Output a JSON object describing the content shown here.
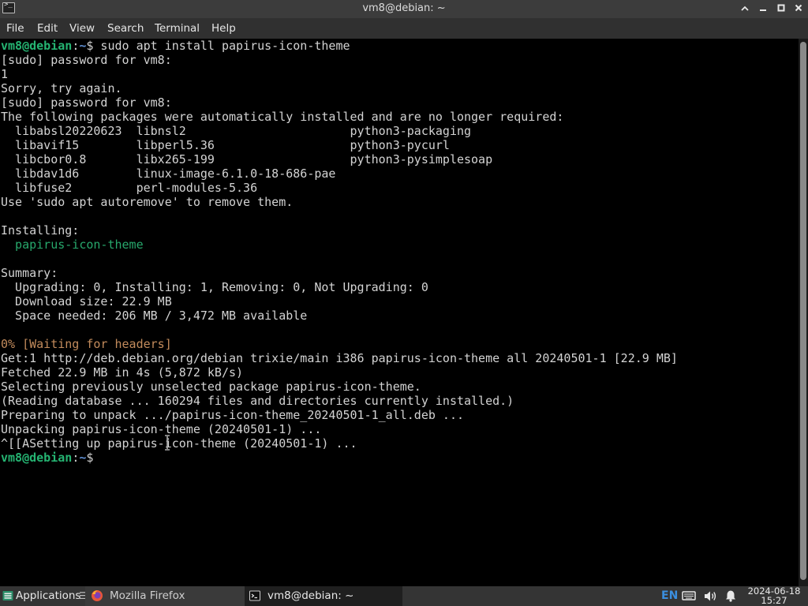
{
  "window": {
    "title": "vm8@debian: ~",
    "icon": "terminal-icon",
    "controls": [
      "minimize-up-icon",
      "minimize-icon",
      "maximize-icon",
      "close-icon"
    ]
  },
  "menu": [
    "File",
    "Edit",
    "View",
    "Search",
    "Terminal",
    "Help"
  ],
  "terminal": {
    "prompt_user": "vm8@debian",
    "prompt_sep": ":",
    "prompt_path": "~",
    "prompt_symbol": "$",
    "command": " sudo apt install papirus-icon-theme",
    "lines": [
      "[sudo] password for vm8:",
      "1",
      "Sorry, try again.",
      "[sudo] password for vm8:",
      "The following packages were automatically installed and are no longer required:",
      "  libabsl20220623  libnsl2                       python3-packaging",
      "  libavif15        libperl5.36                   python3-pycurl",
      "  libcbor0.8       libx265-199                   python3-pysimplesoap",
      "  libdav1d6        linux-image-6.1.0-18-686-pae",
      "  libfuse2         perl-modules-5.36",
      "Use 'sudo apt autoremove' to remove them.",
      "",
      "Installing:"
    ],
    "installing_pkg": "  papirus-icon-theme",
    "summary_lines": [
      "",
      "Summary:",
      "  Upgrading: 0, Installing: 1, Removing: 0, Not Upgrading: 0",
      "  Download size: 22.9 MB",
      "  Space needed: 206 MB / 3,472 MB available",
      ""
    ],
    "waiting": "0% [Waiting for headers]",
    "tail_lines": [
      "Get:1 http://deb.debian.org/debian trixie/main i386 papirus-icon-theme all 20240501-1 [22.9 MB]",
      "Fetched 22.9 MB in 4s (5,872 kB/s)",
      "Selecting previously unselected package papirus-icon-theme.",
      "(Reading database ... 160294 files and directories currently installed.)",
      "Preparing to unpack .../papirus-icon-theme_20240501-1_all.deb ...",
      "Unpacking papirus-icon-theme (20240501-1) ...",
      "^[[ASetting up papirus-icon-theme (20240501-1) ..."
    ]
  },
  "taskbar": {
    "apps_label": "Applications",
    "firefox_label": "Mozilla Firefox",
    "terminal_label": "vm8@debian: ~",
    "lang": "EN",
    "date": "2024-06-18",
    "time": "15:27",
    "tray_icons": [
      "keyboard-icon",
      "volume-icon",
      "notification-bell-icon"
    ]
  },
  "colors": {
    "prompt_user": "#25b472",
    "prompt_path": "#5f8fd2",
    "package_highlight": "#27a86c",
    "waiting_status": "#c28b5c",
    "terminal_bg": "#000000",
    "terminal_fg": "#d3d3d3"
  }
}
